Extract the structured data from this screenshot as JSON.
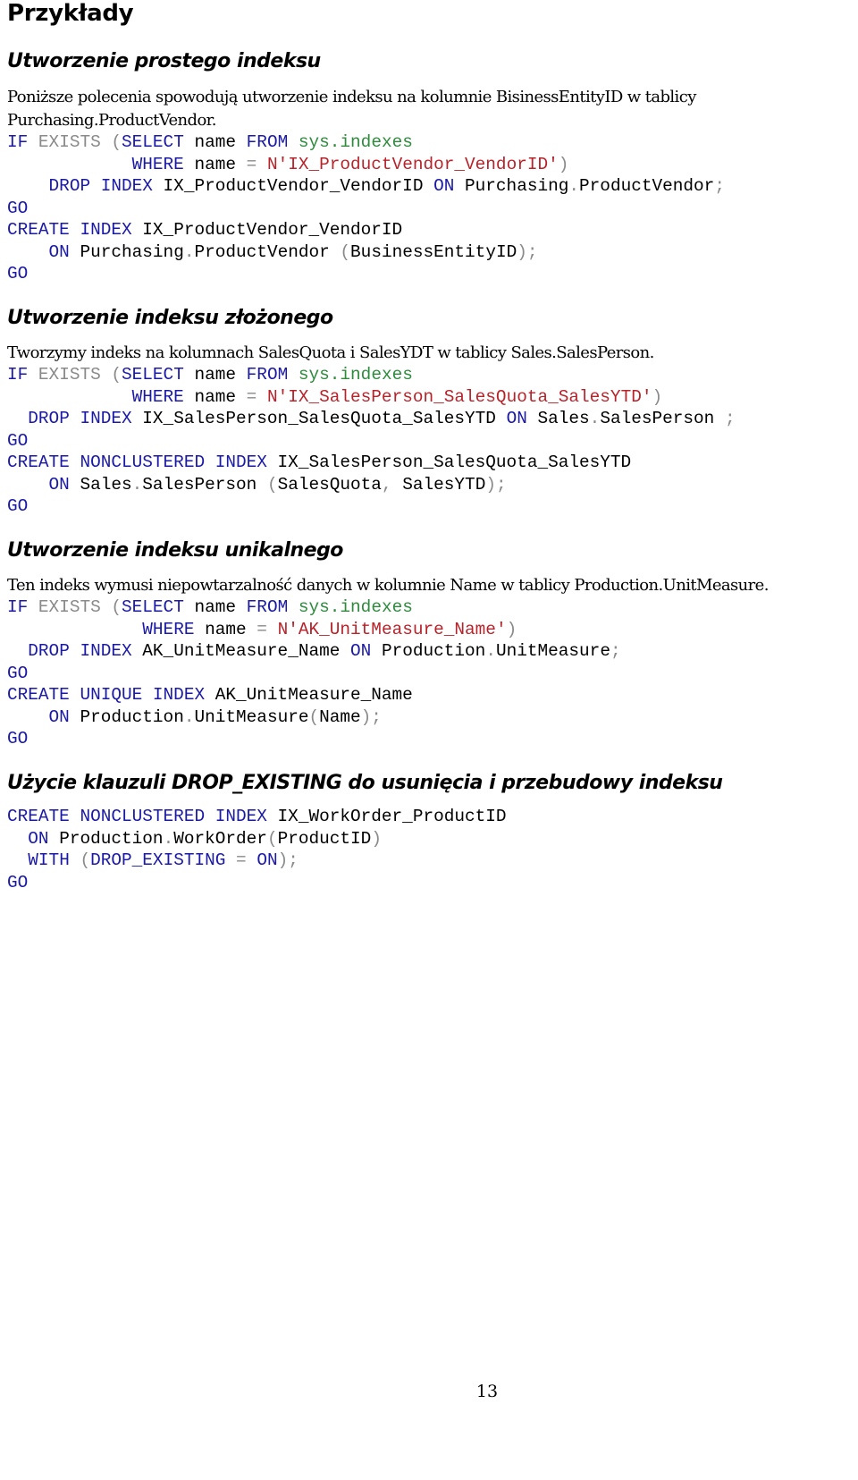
{
  "page_title": "Przykłady",
  "sections": [
    {
      "heading": "Utworzenie prostego indeksu",
      "description_lines": [
        "Poniższe polecenia spowodują utworzenie indeksu na kolumnie BisinessEntityID w tablicy",
        "Purchasing.ProductVendor."
      ],
      "code": [
        [
          [
            "kw",
            "IF "
          ],
          [
            "gr",
            "EXISTS ("
          ],
          [
            "kw",
            "SELECT "
          ],
          [
            "tx",
            "name "
          ],
          [
            "kw",
            "FROM "
          ],
          [
            "fn",
            "sys.indexes"
          ]
        ],
        [
          [
            "tx",
            "            "
          ],
          [
            "kw",
            "WHERE "
          ],
          [
            "tx",
            "name "
          ],
          [
            "gr",
            "= "
          ],
          [
            "st",
            "N'IX_ProductVendor_VendorID'"
          ],
          [
            "gr",
            ")"
          ]
        ],
        [
          [
            "tx",
            "    "
          ],
          [
            "kw",
            "DROP INDEX "
          ],
          [
            "tx",
            "IX_ProductVendor_VendorID "
          ],
          [
            "kw",
            "ON "
          ],
          [
            "tx",
            "Purchasing"
          ],
          [
            "gr",
            "."
          ],
          [
            "tx",
            "ProductVendor"
          ],
          [
            "gr",
            ";"
          ]
        ],
        [
          [
            "kw",
            "GO"
          ]
        ],
        [
          [
            "kw",
            "CREATE INDEX "
          ],
          [
            "tx",
            "IX_ProductVendor_VendorID"
          ]
        ],
        [
          [
            "tx",
            "    "
          ],
          [
            "kw",
            "ON "
          ],
          [
            "tx",
            "Purchasing"
          ],
          [
            "gr",
            "."
          ],
          [
            "tx",
            "ProductVendor "
          ],
          [
            "gr",
            "("
          ],
          [
            "tx",
            "BusinessEntityID"
          ],
          [
            "gr",
            ");"
          ]
        ],
        [
          [
            "kw",
            "GO"
          ]
        ]
      ]
    },
    {
      "heading": "Utworzenie indeksu złożonego",
      "description_lines": [
        "Tworzymy indeks na kolumnach SalesQuota i SalesYDT w tablicy Sales.SalesPerson."
      ],
      "code": [
        [
          [
            "kw",
            "IF "
          ],
          [
            "gr",
            "EXISTS ("
          ],
          [
            "kw",
            "SELECT "
          ],
          [
            "tx",
            "name "
          ],
          [
            "kw",
            "FROM "
          ],
          [
            "fn",
            "sys.indexes"
          ]
        ],
        [
          [
            "tx",
            "            "
          ],
          [
            "kw",
            "WHERE "
          ],
          [
            "tx",
            "name "
          ],
          [
            "gr",
            "= "
          ],
          [
            "st",
            "N'IX_SalesPerson_SalesQuota_SalesYTD'"
          ],
          [
            "gr",
            ")"
          ]
        ],
        [
          [
            "tx",
            "  "
          ],
          [
            "kw",
            "DROP INDEX "
          ],
          [
            "tx",
            "IX_SalesPerson_SalesQuota_SalesYTD "
          ],
          [
            "kw",
            "ON "
          ],
          [
            "tx",
            "Sales"
          ],
          [
            "gr",
            "."
          ],
          [
            "tx",
            "SalesPerson "
          ],
          [
            "gr",
            ";"
          ]
        ],
        [
          [
            "kw",
            "GO"
          ]
        ],
        [
          [
            "kw",
            "CREATE NONCLUSTERED INDEX "
          ],
          [
            "tx",
            "IX_SalesPerson_SalesQuota_SalesYTD"
          ]
        ],
        [
          [
            "tx",
            "    "
          ],
          [
            "kw",
            "ON "
          ],
          [
            "tx",
            "Sales"
          ],
          [
            "gr",
            "."
          ],
          [
            "tx",
            "SalesPerson "
          ],
          [
            "gr",
            "("
          ],
          [
            "tx",
            "SalesQuota"
          ],
          [
            "gr",
            ", "
          ],
          [
            "tx",
            "SalesYTD"
          ],
          [
            "gr",
            ");"
          ]
        ],
        [
          [
            "kw",
            "GO"
          ]
        ]
      ]
    },
    {
      "heading": "Utworzenie indeksu unikalnego",
      "description_lines": [
        "Ten indeks wymusi niepowtarzalność danych w kolumnie Name w tablicy Production.UnitMeasure."
      ],
      "code": [
        [
          [
            "kw",
            "IF "
          ],
          [
            "gr",
            "EXISTS ("
          ],
          [
            "kw",
            "SELECT "
          ],
          [
            "tx",
            "name "
          ],
          [
            "kw",
            "FROM "
          ],
          [
            "fn",
            "sys.indexes"
          ]
        ],
        [
          [
            "tx",
            "             "
          ],
          [
            "kw",
            "WHERE "
          ],
          [
            "tx",
            "name "
          ],
          [
            "gr",
            "= "
          ],
          [
            "st",
            "N'AK_UnitMeasure_Name'"
          ],
          [
            "gr",
            ")"
          ]
        ],
        [
          [
            "tx",
            "  "
          ],
          [
            "kw",
            "DROP INDEX "
          ],
          [
            "tx",
            "AK_UnitMeasure_Name "
          ],
          [
            "kw",
            "ON "
          ],
          [
            "tx",
            "Production"
          ],
          [
            "gr",
            "."
          ],
          [
            "tx",
            "UnitMeasure"
          ],
          [
            "gr",
            ";"
          ]
        ],
        [
          [
            "kw",
            "GO"
          ]
        ],
        [
          [
            "kw",
            "CREATE UNIQUE INDEX "
          ],
          [
            "tx",
            "AK_UnitMeasure_Name"
          ]
        ],
        [
          [
            "tx",
            "    "
          ],
          [
            "kw",
            "ON "
          ],
          [
            "tx",
            "Production"
          ],
          [
            "gr",
            "."
          ],
          [
            "tx",
            "UnitMeasure"
          ],
          [
            "gr",
            "("
          ],
          [
            "tx",
            "Name"
          ],
          [
            "gr",
            ");"
          ]
        ],
        [
          [
            "kw",
            "GO"
          ]
        ]
      ]
    },
    {
      "heading": "Użycie klauzuli DROP_EXISTING do usunięcia i przebudowy indeksu",
      "description_lines": [],
      "code": [
        [
          [
            "kw",
            "CREATE NONCLUSTERED INDEX "
          ],
          [
            "tx",
            "IX_WorkOrder_ProductID"
          ]
        ],
        [
          [
            "tx",
            "  "
          ],
          [
            "kw",
            "ON "
          ],
          [
            "tx",
            "Production"
          ],
          [
            "gr",
            "."
          ],
          [
            "tx",
            "WorkOrder"
          ],
          [
            "gr",
            "("
          ],
          [
            "tx",
            "ProductID"
          ],
          [
            "gr",
            ")"
          ]
        ],
        [
          [
            "tx",
            "  "
          ],
          [
            "kw",
            "WITH "
          ],
          [
            "gr",
            "("
          ],
          [
            "kw",
            "DROP_EXISTING "
          ],
          [
            "gr",
            "= "
          ],
          [
            "kw",
            "ON"
          ],
          [
            "gr",
            ");"
          ]
        ],
        [
          [
            "kw",
            "GO"
          ]
        ]
      ]
    }
  ],
  "page_number": "13",
  "colors": {
    "keyword": "#1a1aa6",
    "operator": "#8a8a8a",
    "system_object": "#2e8b3c",
    "string": "#b8232a",
    "text": "#000000"
  }
}
